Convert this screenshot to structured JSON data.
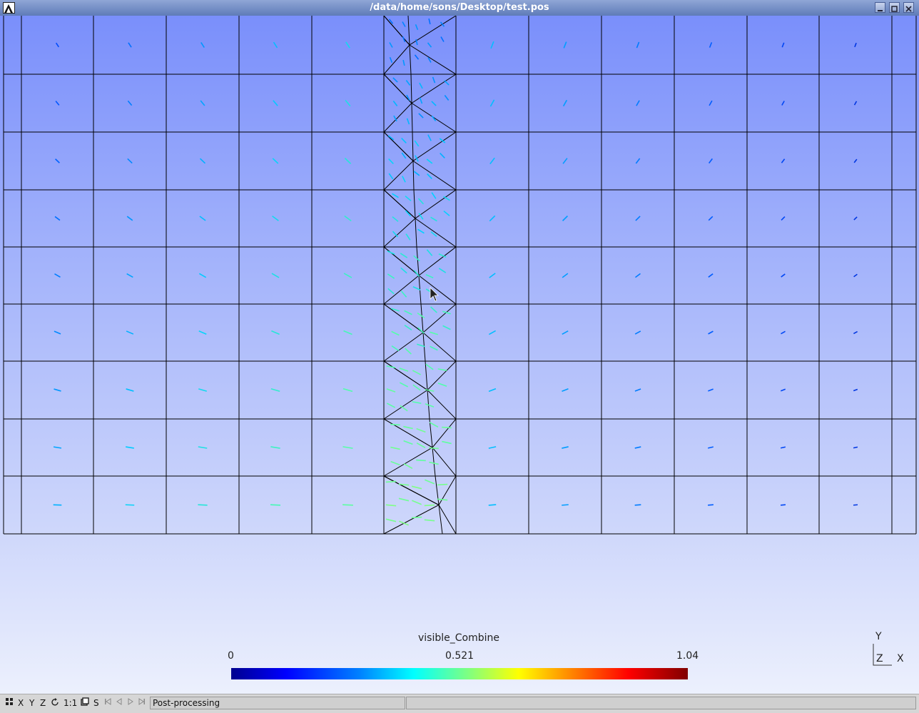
{
  "window": {
    "title": "/data/home/sons/Desktop/test.pos"
  },
  "legend": {
    "title": "visible_Combine",
    "min_label": "0",
    "mid_label": "0.521",
    "max_label": "1.04",
    "colors": [
      "#00008f",
      "#0000ff",
      "#0080ff",
      "#00ffff",
      "#80ff80",
      "#ffff00",
      "#ff8000",
      "#ff0000",
      "#800000"
    ]
  },
  "axes": {
    "y": "Y",
    "z": "Z",
    "x": "X"
  },
  "toolbar": {
    "x_label": "X",
    "y_label": "Y",
    "z_label": "Z",
    "one_to_one_label": "1:1",
    "s_label": "S"
  },
  "status": {
    "text": "Post-processing"
  }
}
